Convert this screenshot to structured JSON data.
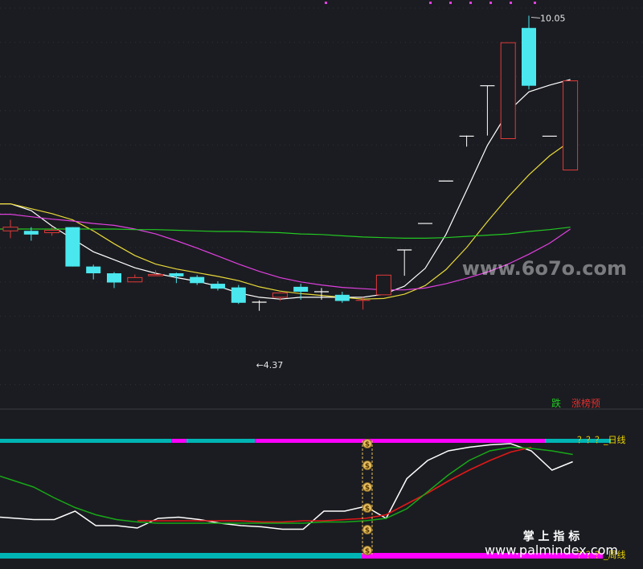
{
  "chart_data": [
    {
      "type": "candlestick",
      "panel": "price",
      "title": "",
      "xlabel": "",
      "ylabel": "",
      "ylim": [
        3.9,
        10.2
      ],
      "grid": true,
      "candles": [
        {
          "o": 6.55,
          "c": 6.61,
          "h": 6.73,
          "l": 6.43
        },
        {
          "o": 6.55,
          "c": 6.49,
          "h": 6.61,
          "l": 6.39
        },
        {
          "o": 6.52,
          "c": 6.56,
          "h": 6.61,
          "l": 6.47
        },
        {
          "o": 6.61,
          "c": 5.97,
          "h": 6.61,
          "l": 5.97
        },
        {
          "o": 5.97,
          "c": 5.86,
          "h": 6.0,
          "l": 5.76
        },
        {
          "o": 5.86,
          "c": 5.71,
          "h": 5.88,
          "l": 5.62
        },
        {
          "o": 5.72,
          "c": 5.79,
          "h": 5.84,
          "l": 5.72
        },
        {
          "o": 5.82,
          "c": 5.84,
          "h": 5.91,
          "l": 5.82
        },
        {
          "o": 5.86,
          "c": 5.81,
          "h": 5.87,
          "l": 5.7
        },
        {
          "o": 5.8,
          "c": 5.7,
          "h": 5.83,
          "l": 5.67
        },
        {
          "o": 5.69,
          "c": 5.61,
          "h": 5.73,
          "l": 5.58
        },
        {
          "o": 5.63,
          "c": 5.38,
          "h": 5.67,
          "l": 5.36
        },
        {
          "o": 5.39,
          "c": 5.39,
          "h": 5.42,
          "l": 5.25
        },
        {
          "o": 5.47,
          "c": 5.54,
          "h": 5.55,
          "l": 5.41
        },
        {
          "o": 5.64,
          "c": 5.56,
          "h": 5.69,
          "l": 5.43
        },
        {
          "o": 5.56,
          "c": 5.56,
          "h": 5.62,
          "l": 5.43
        },
        {
          "o": 5.51,
          "c": 5.41,
          "h": 5.56,
          "l": 5.38
        },
        {
          "o": 5.41,
          "c": 5.42,
          "h": 5.47,
          "l": 5.27
        },
        {
          "o": 5.51,
          "c": 5.83,
          "h": 5.83,
          "l": 5.51
        },
        {
          "o": 6.24,
          "c": 6.24,
          "h": 6.24,
          "l": 5.82
        },
        {
          "o": 6.67,
          "c": 6.67,
          "h": 6.67,
          "l": 6.67
        },
        {
          "o": 7.36,
          "c": 7.36,
          "h": 7.36,
          "l": 7.36
        },
        {
          "o": 8.09,
          "c": 8.09,
          "h": 8.1,
          "l": 7.92
        },
        {
          "o": 8.91,
          "c": 8.91,
          "h": 8.91,
          "l": 8.1
        },
        {
          "o": 8.05,
          "c": 9.61,
          "h": 9.61,
          "l": 8.05
        },
        {
          "o": 9.85,
          "c": 8.91,
          "h": 10.05,
          "l": 8.85
        },
        {
          "o": 8.09,
          "c": 8.09,
          "h": 8.09,
          "l": 8.09
        },
        {
          "o": 7.54,
          "c": 8.99,
          "h": 8.99,
          "l": 7.54
        }
      ],
      "series": [
        {
          "color": "#ffffff",
          "values": [
            6.99,
            6.88,
            6.63,
            6.42,
            6.21,
            6.08,
            5.95,
            5.86,
            5.79,
            5.73,
            5.65,
            5.54,
            5.47,
            5.44,
            5.47,
            5.47,
            5.47,
            5.47,
            5.52,
            5.65,
            5.94,
            6.49,
            7.21,
            7.94,
            8.49,
            8.81,
            8.92,
            9.01
          ]
        },
        {
          "color": "#e8d93a",
          "values": [
            6.99,
            6.91,
            6.83,
            6.73,
            6.55,
            6.34,
            6.15,
            6.01,
            5.93,
            5.87,
            5.81,
            5.74,
            5.64,
            5.57,
            5.53,
            5.5,
            5.47,
            5.44,
            5.45,
            5.52,
            5.66,
            5.92,
            6.28,
            6.7,
            7.1,
            7.46,
            7.77,
            8.01
          ]
        },
        {
          "color": "#e040e0",
          "values": [
            6.82,
            6.78,
            6.74,
            6.71,
            6.67,
            6.64,
            6.58,
            6.5,
            6.39,
            6.27,
            6.14,
            6.01,
            5.89,
            5.79,
            5.72,
            5.67,
            5.63,
            5.61,
            5.59,
            5.59,
            5.62,
            5.69,
            5.78,
            5.88,
            6.01,
            6.17,
            6.35,
            6.58
          ]
        },
        {
          "color": "#22c822",
          "values": [
            6.58,
            6.58,
            6.58,
            6.58,
            6.58,
            6.58,
            6.57,
            6.57,
            6.56,
            6.55,
            6.54,
            6.54,
            6.53,
            6.52,
            6.5,
            6.49,
            6.47,
            6.45,
            6.44,
            6.43,
            6.43,
            6.44,
            6.46,
            6.48,
            6.5,
            6.54,
            6.57,
            6.61
          ]
        }
      ],
      "annotations": [
        {
          "text": "10.05",
          "x": 25,
          "y": 10.05
        },
        {
          "text": "←4.37",
          "x": 12,
          "y": 4.37
        },
        {
          "text": "跌",
          "color": "#22c822"
        },
        {
          "text": "涨榜预",
          "color": "#e03030"
        }
      ]
    },
    {
      "type": "line",
      "panel": "indicator",
      "ylim": [
        0,
        100
      ],
      "series": [
        {
          "color": "#ffffff",
          "values": [
            31,
            29,
            29,
            36,
            24,
            24,
            22,
            30,
            31,
            29,
            26,
            24,
            23,
            21,
            21,
            36,
            36,
            40,
            30,
            63,
            78,
            86,
            89,
            91,
            92,
            86,
            70,
            77
          ]
        },
        {
          "color": "#e01818",
          "values": [
            null,
            null,
            null,
            null,
            null,
            null,
            28,
            28,
            28,
            28,
            28,
            28,
            27,
            27,
            28,
            28,
            29,
            30,
            33,
            42,
            51,
            61,
            70,
            78,
            85,
            89,
            null,
            null
          ]
        },
        {
          "color": "#18a818",
          "values": [
            65,
            56,
            47,
            39,
            33,
            29,
            27,
            26,
            26,
            26,
            26,
            26,
            26,
            26,
            26,
            27,
            27,
            28,
            30,
            38,
            52,
            66,
            78,
            86,
            89,
            88,
            86,
            83
          ]
        }
      ],
      "bands": [
        {
          "name": "？？？_日线",
          "colors": [
            "#00b4b4",
            "#ff00ff",
            "#00b4b4",
            "#ff00ff",
            "#00b4b4"
          ]
        },
        {
          "name": "？？？_周线",
          "colors": [
            "#00b4b4",
            "#ff00ff"
          ]
        }
      ]
    }
  ],
  "watermarks": {
    "line1": "www.6o7o.com",
    "line2": "掌 上 指 标",
    "line3": "www.palmindex.com"
  },
  "colors": {
    "background": "#1b1c21",
    "up": "#e03a3a",
    "down": "#4ae8ee",
    "band_cyan": "#00b4b4",
    "band_magenta": "#ff00ff",
    "coin": "#e8c060"
  }
}
